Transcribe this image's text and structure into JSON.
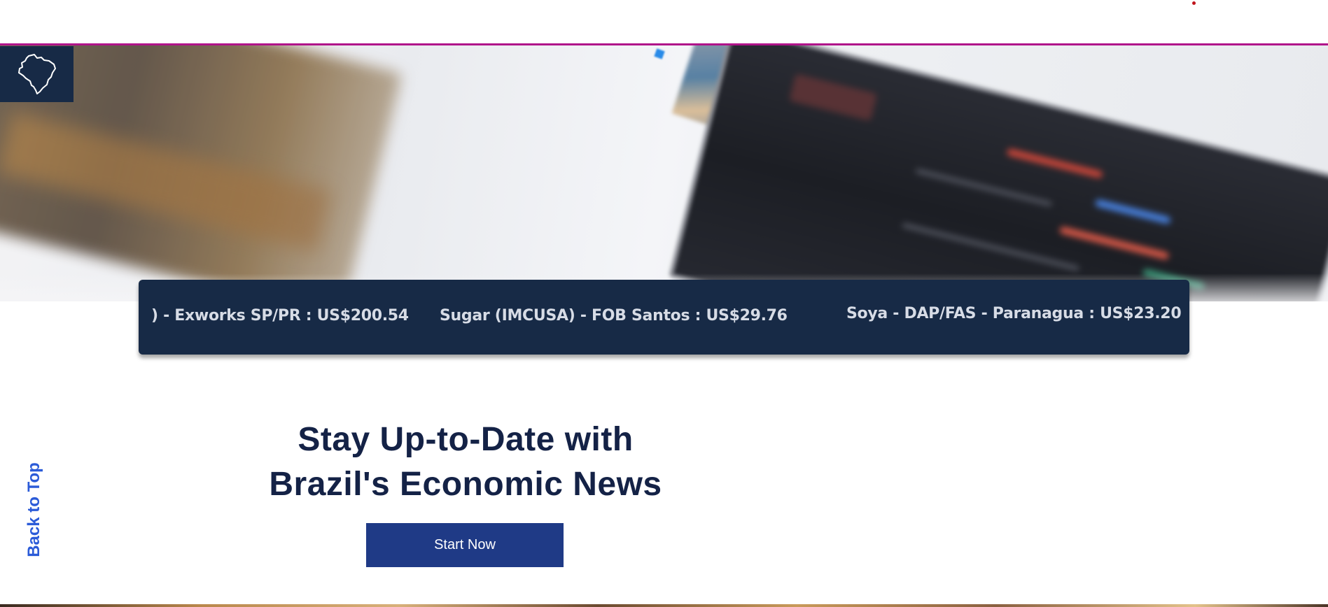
{
  "header": {
    "accent_line_color": "#b0138a"
  },
  "logo": {
    "icon": "brazil-map-icon",
    "background": "#172a46"
  },
  "ticker": {
    "items": [
      ") - Exworks SP/PR : US$200.54",
      "Sugar (IMCUSA) - FOB Santos : US$29.76",
      "Soya - DAP/FAS - Paranagua : US$23.20"
    ]
  },
  "hero": {
    "title_line1": "Stay Up-to-Date with",
    "title_line2": "Brazil's Economic News",
    "cta_label": "Start Now"
  },
  "back_to_top": {
    "label": "Back to Top"
  },
  "colors": {
    "navy": "#172a46",
    "button": "#1f3a86",
    "link": "#2b5bd8",
    "headline": "#142246"
  }
}
